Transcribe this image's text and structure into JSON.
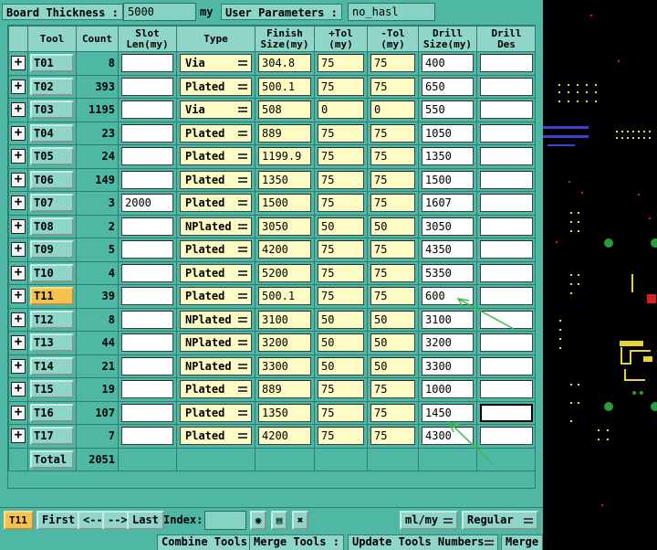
{
  "top_bar": {
    "board_thickness_label": "Board Thickness :",
    "board_thickness_value": "5000",
    "board_thickness_unit": "my",
    "user_parameters_label": "User Parameters :",
    "user_parameters_value": "no_hasl"
  },
  "table": {
    "headers": {
      "tool": "Tool",
      "count": "Count",
      "slot_len_1": "Slot",
      "slot_len_2": "Len(my)",
      "type": "Type",
      "finish_1": "Finish",
      "finish_2": "Size(my)",
      "ptol_1": "+Tol",
      "ptol_2": "(my)",
      "mtol_1": "-Tol",
      "mtol_2": "(my)",
      "drill_1": "Drill",
      "drill_2": "Size(my)",
      "des_1": "Drill",
      "des_2": "Des"
    },
    "rows": [
      {
        "tool": "T01",
        "count": "8",
        "slot": "",
        "type": "Via",
        "finish": "304.8",
        "ptol": "75",
        "mtol": "75",
        "drill": "400",
        "des": ""
      },
      {
        "tool": "T02",
        "count": "393",
        "slot": "",
        "type": "Plated",
        "finish": "500.1",
        "ptol": "75",
        "mtol": "75",
        "drill": "650",
        "des": ""
      },
      {
        "tool": "T03",
        "count": "1195",
        "slot": "",
        "type": "Via",
        "finish": "508",
        "ptol": "0",
        "mtol": "0",
        "drill": "550",
        "des": ""
      },
      {
        "tool": "T04",
        "count": "23",
        "slot": "",
        "type": "Plated",
        "finish": "889",
        "ptol": "75",
        "mtol": "75",
        "drill": "1050",
        "des": ""
      },
      {
        "tool": "T05",
        "count": "24",
        "slot": "",
        "type": "Plated",
        "finish": "1199.9",
        "ptol": "75",
        "mtol": "75",
        "drill": "1350",
        "des": ""
      },
      {
        "tool": "T06",
        "count": "149",
        "slot": "",
        "type": "Plated",
        "finish": "1350",
        "ptol": "75",
        "mtol": "75",
        "drill": "1500",
        "des": ""
      },
      {
        "tool": "T07",
        "count": "3",
        "slot": "2000",
        "type": "Plated",
        "finish": "1500",
        "ptol": "75",
        "mtol": "75",
        "drill": "1607",
        "des": ""
      },
      {
        "tool": "T08",
        "count": "2",
        "slot": "",
        "type": "NPlated",
        "finish": "3050",
        "ptol": "50",
        "mtol": "50",
        "drill": "3050",
        "des": ""
      },
      {
        "tool": "T09",
        "count": "5",
        "slot": "",
        "type": "Plated",
        "finish": "4200",
        "ptol": "75",
        "mtol": "75",
        "drill": "4350",
        "des": ""
      },
      {
        "tool": "T10",
        "count": "4",
        "slot": "",
        "type": "Plated",
        "finish": "5200",
        "ptol": "75",
        "mtol": "75",
        "drill": "5350",
        "des": ""
      },
      {
        "tool": "T11",
        "count": "39",
        "slot": "",
        "type": "Plated",
        "finish": "500.1",
        "ptol": "75",
        "mtol": "75",
        "drill": "600",
        "des": "",
        "selected": true
      },
      {
        "tool": "T12",
        "count": "8",
        "slot": "",
        "type": "NPlated",
        "finish": "3100",
        "ptol": "50",
        "mtol": "50",
        "drill": "3100",
        "des": ""
      },
      {
        "tool": "T13",
        "count": "44",
        "slot": "",
        "type": "NPlated",
        "finish": "3200",
        "ptol": "50",
        "mtol": "50",
        "drill": "3200",
        "des": ""
      },
      {
        "tool": "T14",
        "count": "21",
        "slot": "",
        "type": "NPlated",
        "finish": "3300",
        "ptol": "50",
        "mtol": "50",
        "drill": "3300",
        "des": ""
      },
      {
        "tool": "T15",
        "count": "19",
        "slot": "",
        "type": "Plated",
        "finish": "889",
        "ptol": "75",
        "mtol": "75",
        "drill": "1000",
        "des": ""
      },
      {
        "tool": "T16",
        "count": "107",
        "slot": "",
        "type": "Plated",
        "finish": "1350",
        "ptol": "75",
        "mtol": "75",
        "drill": "1450",
        "des": "",
        "des_focused": true
      },
      {
        "tool": "T17",
        "count": "7",
        "slot": "",
        "type": "Plated",
        "finish": "4200",
        "ptol": "75",
        "mtol": "75",
        "drill": "4300",
        "des": ""
      }
    ],
    "total_label": "Total",
    "total_count": "2051"
  },
  "nav_bar": {
    "current_tool": "T11",
    "first_label": "First",
    "prev_label": "<--",
    "next_label": "-->",
    "last_label": "Last",
    "index_label": "Index:",
    "unit_select": "ml/my",
    "mode_select": "Regular"
  },
  "action_bar": {
    "combine_tools": "Combine Tools",
    "merge_tools": "Merge Tools :",
    "update_tools_numbers": "Update Tools Numbers",
    "merge": "Merge"
  },
  "colors": {
    "panel_bg": "#4fb8a5",
    "header_bg": "#8fd6c8",
    "field_yellow": "#fffbc4",
    "selected_orange": "#f5c34a",
    "annotation_arrow": "#3dbb4a"
  },
  "icons": [
    "add-row-icon",
    "bulb-icon",
    "save-icon",
    "delete-icon",
    "dropdown-icon"
  ]
}
